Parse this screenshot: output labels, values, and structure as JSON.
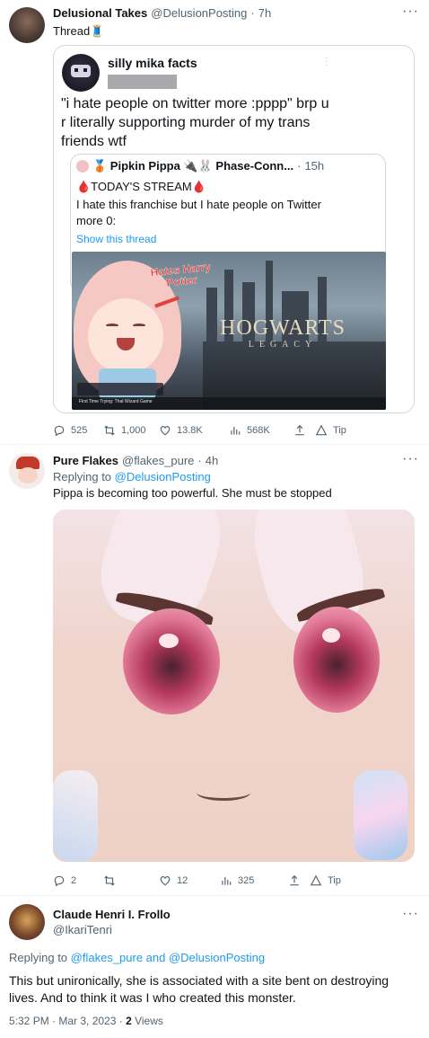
{
  "tweet1": {
    "name": "Delusional Takes",
    "handle": "@DelusionPosting",
    "time": "7h",
    "text": "Thread🧵",
    "quote": {
      "name": "silly mika facts",
      "text": "\"i hate people on twitter more :pppp\" brp u r literally supporting murder of my trans friends wtf",
      "inner": {
        "name": "🥉 Pipkin Pippa 🔌🐰 Phase-Conn...",
        "time": "15h",
        "line1": "🩸TODAY'S STREAM🩸",
        "line2": "I hate this franchise but I hate people on Twitter more 0:",
        "show_thread": "Show this thread"
      },
      "image": {
        "callout": "Hates Harry Potter",
        "logo": "HOGWARTS",
        "logo_sub": "LEGACY",
        "caption": "First Time Trying: That Wizard Game"
      }
    },
    "actions": {
      "replies": "525",
      "retweets": "1,000",
      "likes": "13.8K",
      "views": "568K",
      "tip": "Tip"
    }
  },
  "tweet2": {
    "name": "Pure Flakes",
    "handle": "@flakes_pure",
    "time": "4h",
    "replying_prefix": "Replying to ",
    "replying_to": "@DelusionPosting",
    "text": "Pippa is becoming too powerful. She must be stopped",
    "actions": {
      "replies": "2",
      "retweets": "",
      "likes": "12",
      "views": "325",
      "tip": "Tip"
    }
  },
  "tweet3": {
    "name": "Claude Henri I. Frollo",
    "handle": "@IkariTenri",
    "replying_prefix": "Replying to ",
    "replying_to": "@flakes_pure and @DelusionPosting",
    "text": "This but unironically, she is associated with a site bent on destroying lives. And to think it was I who created this monster.",
    "timestamp": "5:32 PM · Mar 3, 2023 · ",
    "views_count": "2",
    "views_label": " Views"
  },
  "colors": {
    "link": "#1d9bf0",
    "muted": "#536471",
    "border": "#cfd9de",
    "callout": "#e0433a"
  }
}
